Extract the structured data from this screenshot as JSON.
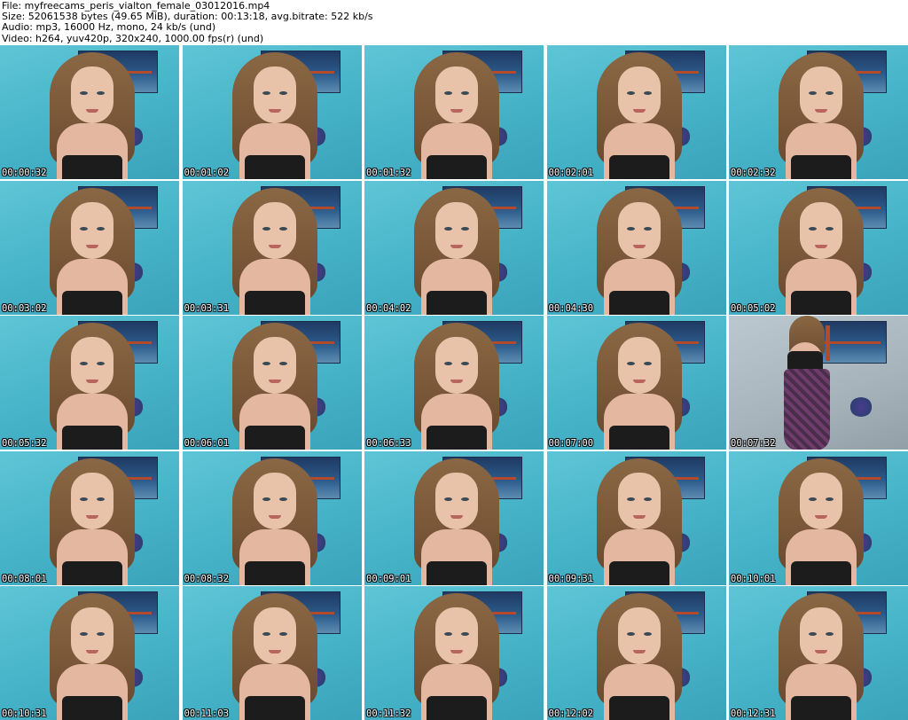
{
  "header": {
    "file_line": "File: myfreecams_peris_vialton_female_03012016.mp4",
    "size_line": "Size: 52061538 bytes (49.65 MiB), duration: 00:13:18, avg.bitrate: 522 kb/s",
    "audio_line": "Audio: mp3, 16000 Hz, mono, 24 kb/s (und)",
    "video_line": "Video: h264, yuv420p, 320x240, 1000.00 fps(r) (und)"
  },
  "thumbnails": [
    {
      "timestamp": "00:00:32"
    },
    {
      "timestamp": "00:01:02"
    },
    {
      "timestamp": "00:01:32"
    },
    {
      "timestamp": "00:02:01"
    },
    {
      "timestamp": "00:02:32"
    },
    {
      "timestamp": "00:03:02"
    },
    {
      "timestamp": "00:03:31"
    },
    {
      "timestamp": "00:04:02"
    },
    {
      "timestamp": "00:04:30"
    },
    {
      "timestamp": "00:05:02"
    },
    {
      "timestamp": "00:05:32"
    },
    {
      "timestamp": "00:06:01"
    },
    {
      "timestamp": "00:06:33"
    },
    {
      "timestamp": "00:07:00"
    },
    {
      "timestamp": "00:07:32"
    },
    {
      "timestamp": "00:08:01"
    },
    {
      "timestamp": "00:08:32"
    },
    {
      "timestamp": "00:09:01"
    },
    {
      "timestamp": "00:09:31"
    },
    {
      "timestamp": "00:10:01"
    },
    {
      "timestamp": "00:10:31"
    },
    {
      "timestamp": "00:11:03"
    },
    {
      "timestamp": "00:11:32"
    },
    {
      "timestamp": "00:12:02"
    },
    {
      "timestamp": "00:12:31"
    }
  ]
}
